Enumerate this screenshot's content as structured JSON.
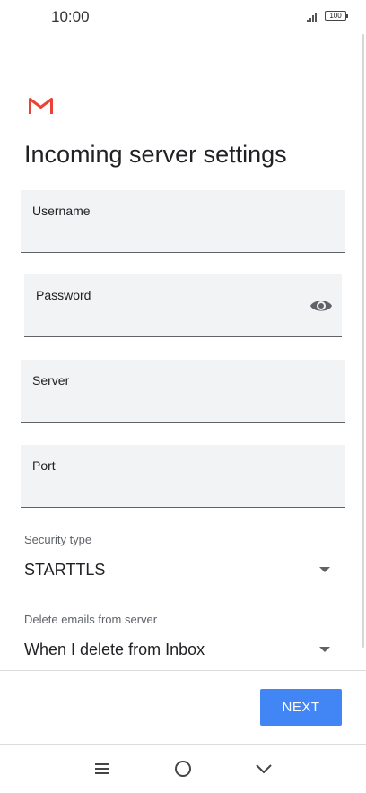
{
  "status_bar": {
    "time": "10:00",
    "battery": "100",
    "signal_icon": "signal-bars-icon",
    "battery_icon": "battery-icon"
  },
  "app": {
    "logo_icon": "gmail-logo-icon",
    "brand_color": "#EA4335"
  },
  "page": {
    "title": "Incoming server settings"
  },
  "form": {
    "username": {
      "label": "Username",
      "value": ""
    },
    "password": {
      "label": "Password",
      "value": "",
      "toggle_icon": "eye-icon"
    },
    "server": {
      "label": "Server",
      "value": ""
    },
    "port": {
      "label": "Port",
      "value": ""
    },
    "security_type": {
      "label": "Security type",
      "value": "STARTTLS"
    },
    "delete_emails": {
      "label": "Delete emails from server",
      "value": "When I delete from Inbox"
    }
  },
  "actions": {
    "next_label": "NEXT",
    "accent_color": "#4285F4"
  },
  "nav_bar": {
    "menu_icon": "menu-icon",
    "home_icon": "home-circle-icon",
    "back_icon": "chevron-down-icon"
  }
}
